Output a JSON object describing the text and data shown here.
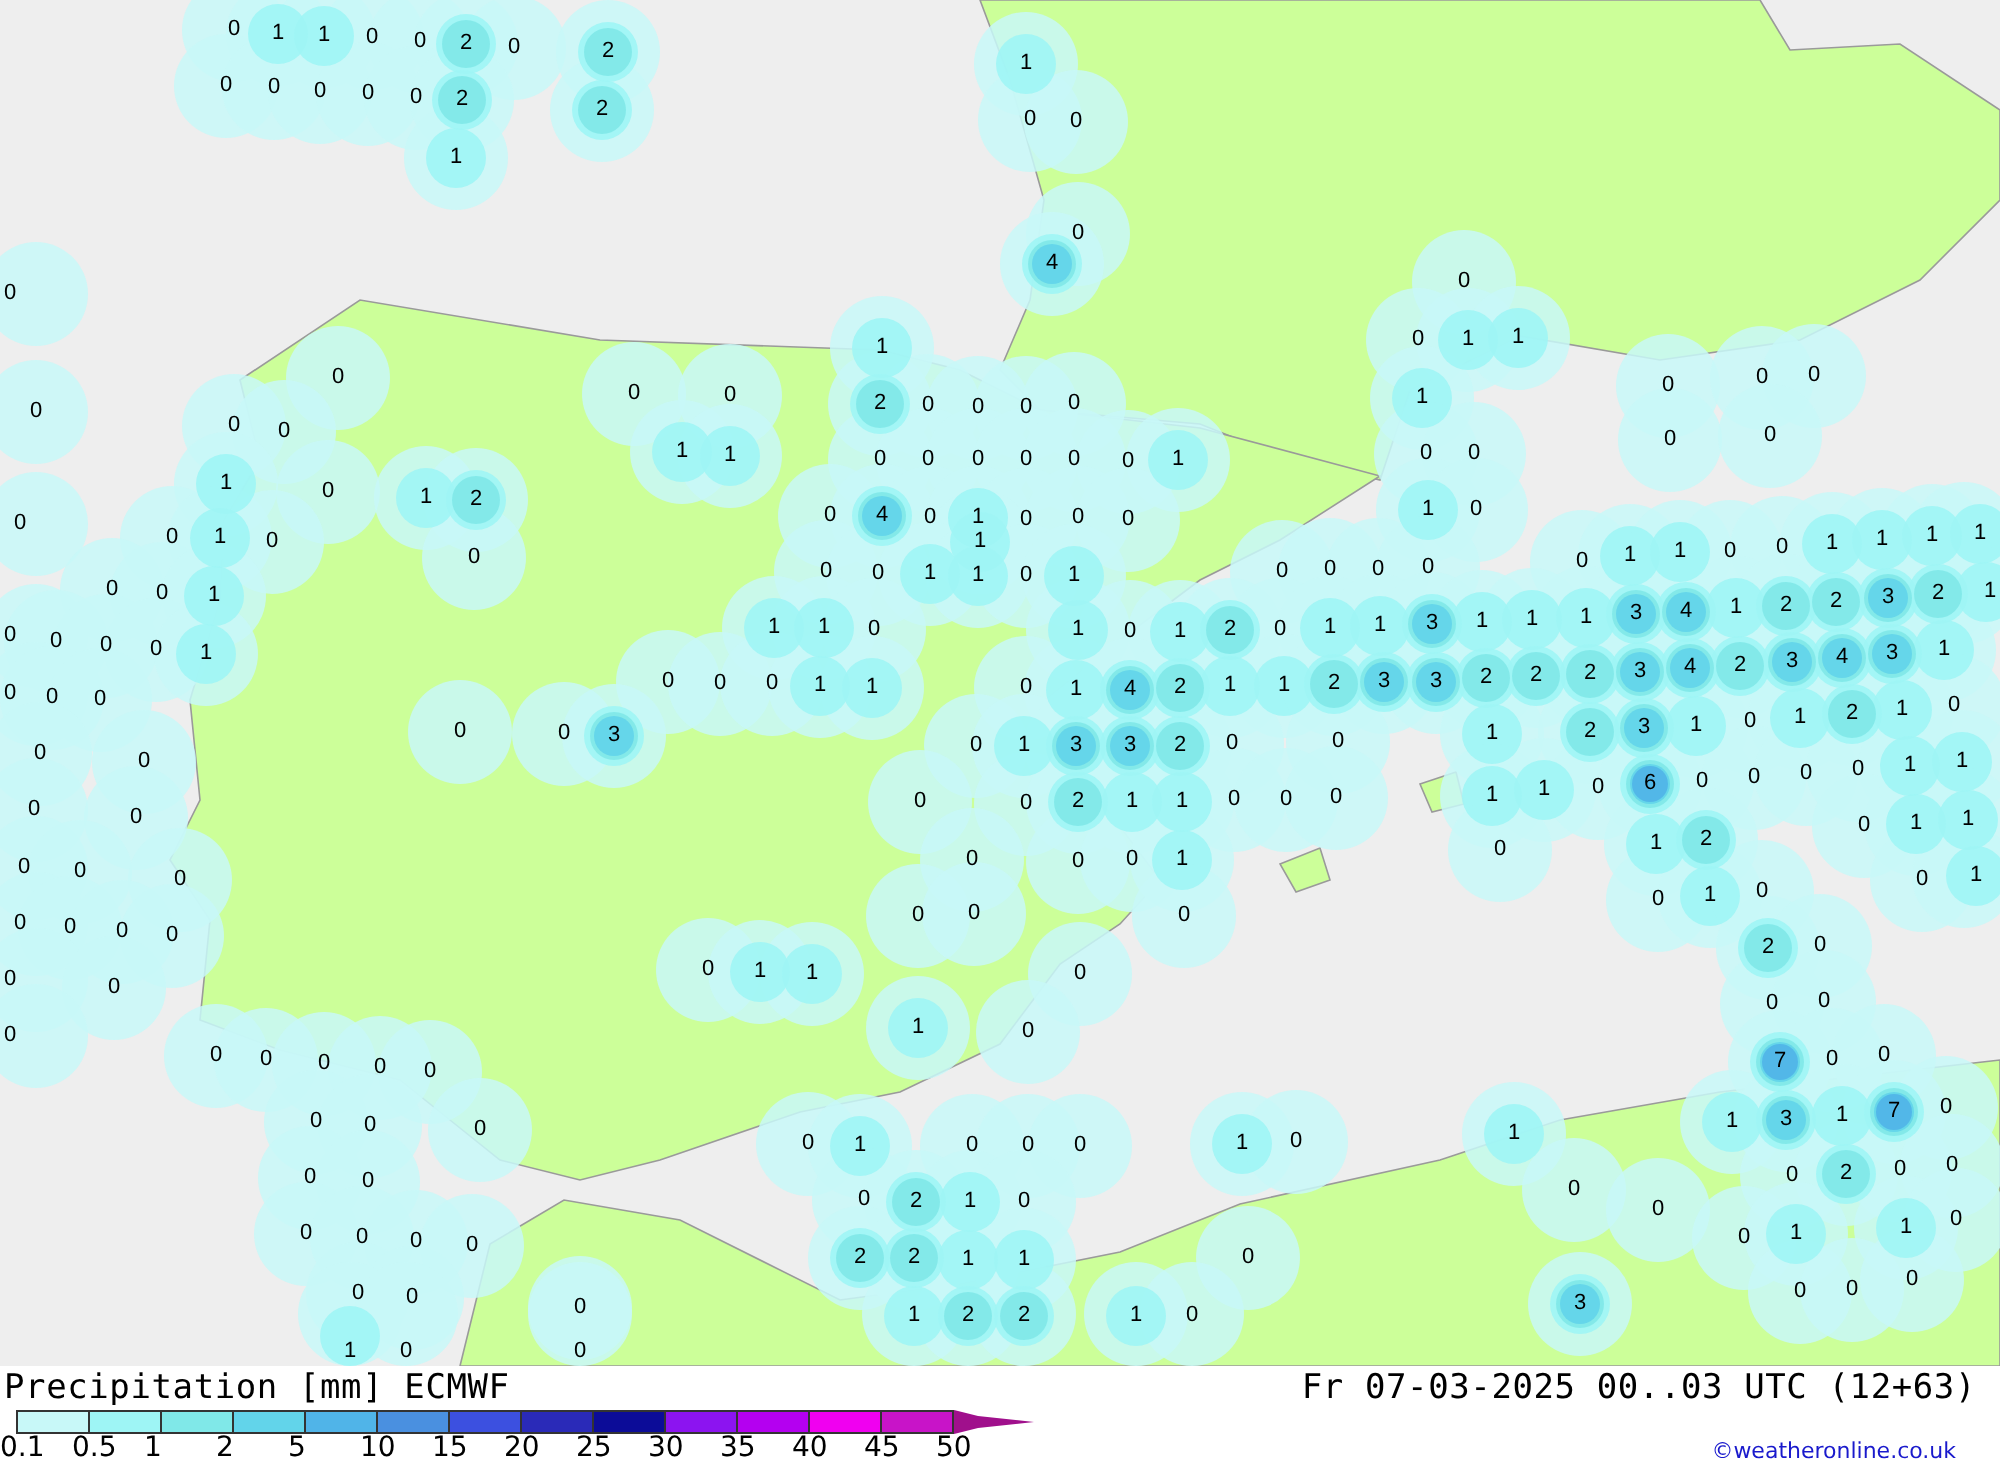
{
  "map_labels": [
    "0",
    "1",
    "1",
    "0",
    "0",
    "2",
    "0",
    "2",
    "0",
    "0",
    "0",
    "0",
    "0",
    "2",
    "2",
    "1",
    "1",
    "0",
    "0",
    "0",
    "4",
    "0",
    "0",
    "1",
    "1",
    "0",
    "0",
    "0",
    "1",
    "0",
    "0",
    "0",
    "0",
    "0",
    "0",
    "1",
    "0",
    "0",
    "2",
    "0",
    "0",
    "0",
    "0",
    "0",
    "0",
    "1",
    "1",
    "0",
    "0",
    "0",
    "0",
    "0",
    "0",
    "1",
    "0",
    "0",
    "1",
    "0",
    "1",
    "2",
    "0",
    "4",
    "0",
    "1",
    "0",
    "0",
    "0",
    "1",
    "0",
    "0",
    "1",
    "0",
    "0",
    "1",
    "0",
    "0",
    "1",
    "1",
    "0",
    "1",
    "0",
    "0",
    "0",
    "0",
    "0",
    "1",
    "1",
    "0",
    "0",
    "1",
    "1",
    "1",
    "1",
    "0",
    "0",
    "1",
    "1",
    "0",
    "1",
    "2",
    "0",
    "1",
    "1",
    "3",
    "1",
    "1",
    "1",
    "3",
    "4",
    "1",
    "2",
    "2",
    "3",
    "2",
    "1",
    "0",
    "0",
    "0",
    "0",
    "1",
    "1",
    "1",
    "0",
    "1",
    "4",
    "2",
    "1",
    "1",
    "2",
    "3",
    "3",
    "2",
    "2",
    "2",
    "3",
    "4",
    "2",
    "3",
    "4",
    "3",
    "1",
    "0",
    "0",
    "0",
    "0",
    "0",
    "0",
    "1",
    "1",
    "0",
    "0",
    "0",
    "3",
    "0",
    "1",
    "3",
    "3",
    "2",
    "0",
    "0",
    "1",
    "2",
    "3",
    "1",
    "0",
    "1",
    "2",
    "1",
    "0",
    "0",
    "0",
    "0",
    "0",
    "2",
    "1",
    "1",
    "0",
    "0",
    "0",
    "1",
    "1",
    "0",
    "6",
    "0",
    "0",
    "0",
    "0",
    "1",
    "1",
    "0",
    "0",
    "0",
    "1",
    "2",
    "0",
    "1",
    "1",
    "0",
    "0",
    "0",
    "0",
    "0",
    "0",
    "1",
    "0",
    "1",
    "0",
    "1",
    "0",
    "0",
    "0",
    "0",
    "0",
    "0",
    "0",
    "0",
    "2",
    "0",
    "0",
    "0",
    "0",
    "1",
    "1",
    "0",
    "0",
    "0",
    "0",
    "1",
    "0",
    "0",
    "0",
    "0",
    "0",
    "0",
    "7",
    "0",
    "0",
    "0",
    "0",
    "0",
    "1",
    "3",
    "1",
    "7",
    "0",
    "0",
    "1",
    "0",
    "0",
    "0",
    "1",
    "0",
    "1",
    "0",
    "0",
    "0",
    "2",
    "0",
    "0",
    "0",
    "2",
    "1",
    "0",
    "0",
    "0",
    "0",
    "0",
    "0",
    "0",
    "1",
    "0",
    "0",
    "1",
    "2",
    "2",
    "1",
    "1",
    "0",
    "0",
    "0",
    "0",
    "0",
    "0",
    "0",
    "1",
    "2",
    "2",
    "1",
    "0",
    "3",
    "1",
    "0",
    "0"
  ],
  "title": "Precipitation [mm] ECMWF",
  "valid_time": "Fr 07-03-2025 00..03 UTC (12+63)",
  "legend": {
    "swatches": [
      {
        "kind": "box",
        "color": "#c8f8f8"
      },
      {
        "kind": "box",
        "color": "#9ef5f5"
      },
      {
        "kind": "box",
        "color": "#80e8e8"
      },
      {
        "kind": "box",
        "color": "#62d4ea"
      },
      {
        "kind": "box",
        "color": "#50b4e8"
      },
      {
        "kind": "box",
        "color": "#4a90e0"
      },
      {
        "kind": "box",
        "color": "#3c50e0"
      },
      {
        "kind": "box",
        "color": "#2a2ab8"
      },
      {
        "kind": "box",
        "color": "#0c0c98"
      },
      {
        "kind": "box",
        "color": "#8c14f0"
      },
      {
        "kind": "box",
        "color": "#b400f0"
      },
      {
        "kind": "box",
        "color": "#f000f0"
      },
      {
        "kind": "box",
        "color": "#c814c8"
      },
      {
        "kind": "arrow",
        "color": "#a0108c"
      }
    ],
    "ticks": [
      "0.1",
      "0.5",
      "1",
      "2",
      "5",
      "10",
      "15",
      "20",
      "25",
      "30",
      "35",
      "40",
      "45",
      "50"
    ]
  },
  "credit": "©weatheronline.co.uk"
}
